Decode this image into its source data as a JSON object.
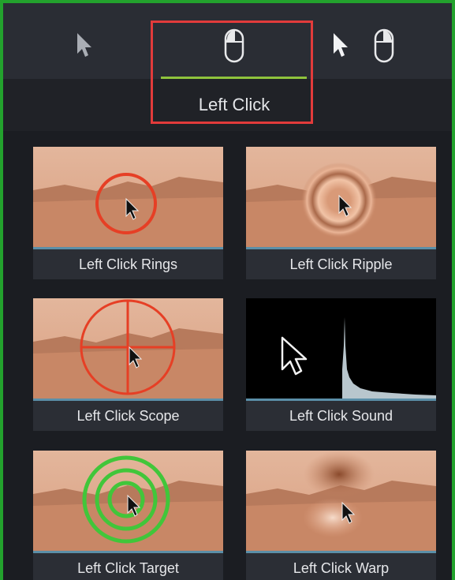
{
  "tabs": {
    "active_label": "Left Click",
    "items": [
      {
        "name": "cursor",
        "icon": "cursor-arrow-icon"
      },
      {
        "name": "left-click",
        "icon": "mouse-icon",
        "active": true
      },
      {
        "name": "right-click",
        "icon": "cursor-mouse-icon"
      }
    ]
  },
  "effects": [
    {
      "label": "Left Click Rings",
      "thumb": "rings"
    },
    {
      "label": "Left Click Ripple",
      "thumb": "ripple"
    },
    {
      "label": "Left Click Scope",
      "thumb": "scope"
    },
    {
      "label": "Left Click Sound",
      "thumb": "sound"
    },
    {
      "label": "Left Click Target",
      "thumb": "target"
    },
    {
      "label": "Left Click Warp",
      "thumb": "warp"
    }
  ],
  "colors": {
    "accent_underline": "#8fc33c",
    "highlight_box": "#e23b3b",
    "frame": "#23a22d"
  }
}
